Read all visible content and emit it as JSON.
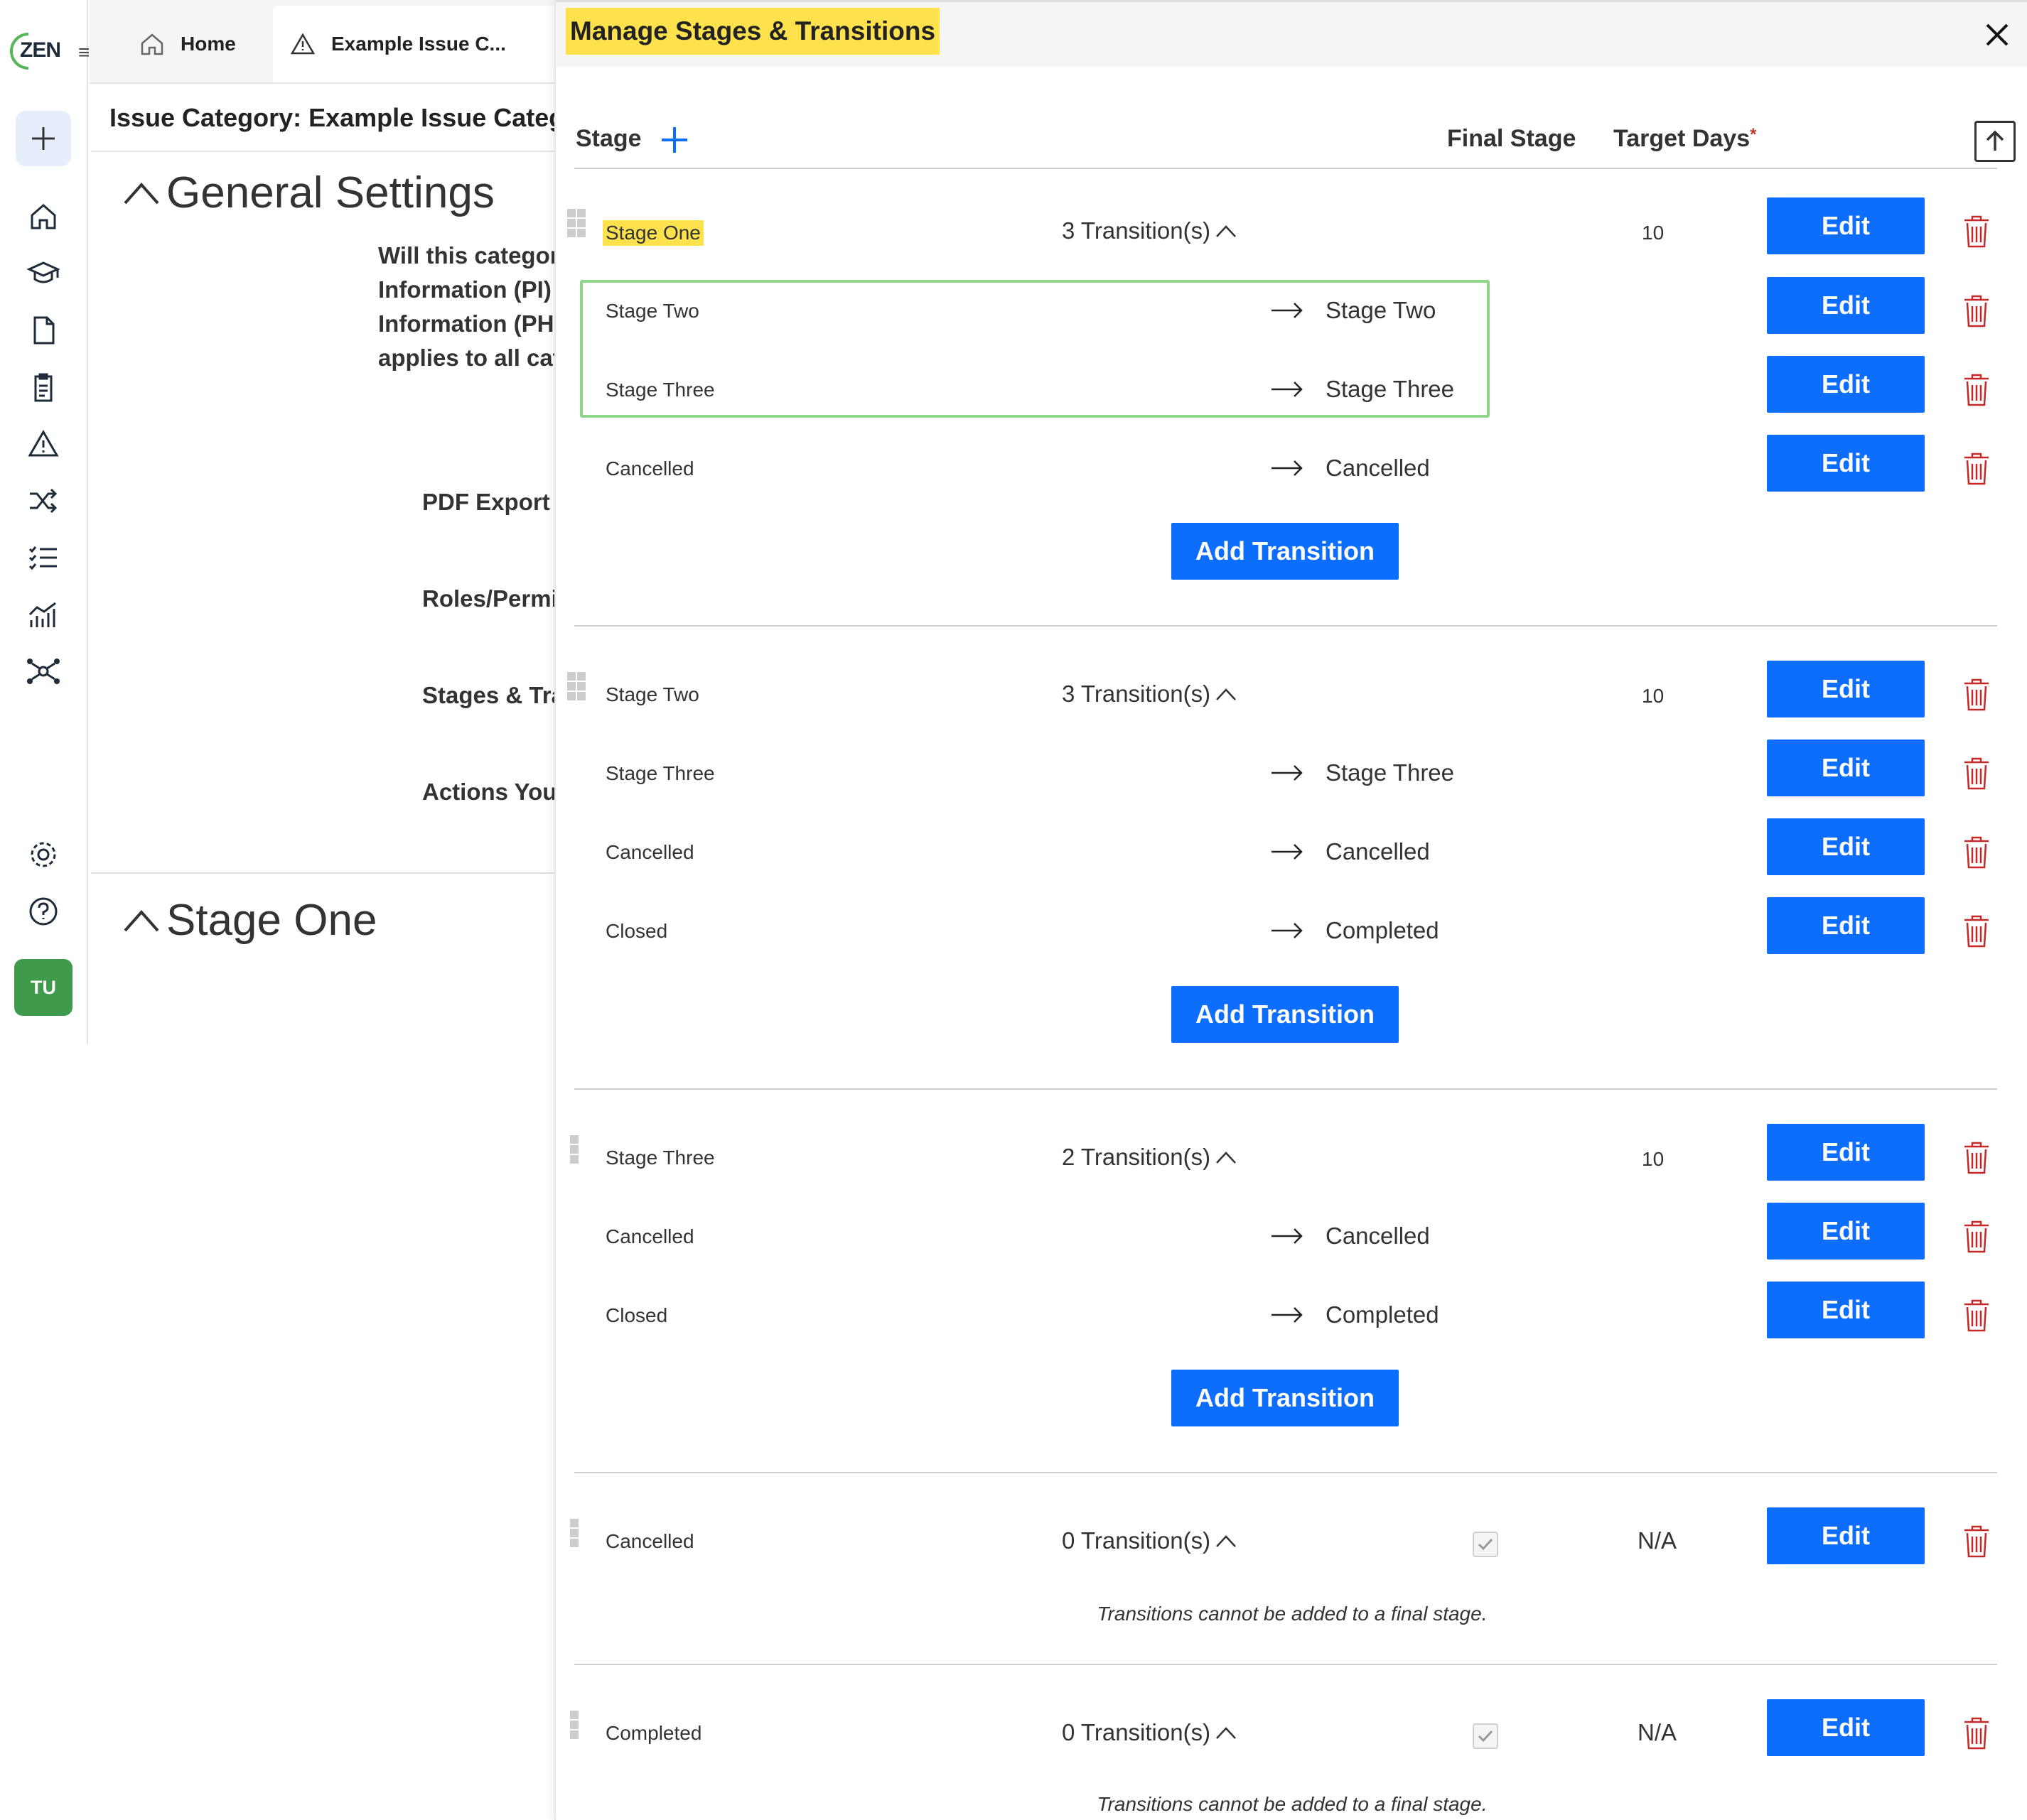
{
  "app": {
    "logo_text": "ZEN",
    "user_initials": "TU"
  },
  "tabs": [
    {
      "label": "Home"
    },
    {
      "label": "Example Issue C...",
      "close": "×"
    }
  ],
  "page": {
    "header": "Issue Category: Example Issue Category",
    "general_settings_title": "General Settings",
    "general_paragraph": [
      "Will this category",
      "Information (PI)",
      "Information (PH",
      "applies to all cate"
    ],
    "labels": [
      "PDF Export",
      "Roles/Permi",
      "Stages & Tra",
      "Actions You"
    ],
    "stage_one_title": "Stage One"
  },
  "modal": {
    "title": "Manage Stages & Transitions",
    "columns": {
      "stage": "Stage",
      "final_stage": "Final Stage",
      "target_days": "Target Days",
      "required_mark": "*"
    },
    "edit_label": "Edit",
    "add_transition_label": "Add Transition",
    "final_note": "Transitions cannot be added to a final stage.",
    "stages": [
      {
        "name": "Stage One",
        "transitions_count": "3 Transition(s)",
        "target_days": "10",
        "transitions": [
          {
            "name": "Stage Two",
            "target": "Stage Two"
          },
          {
            "name": "Stage Three",
            "target": "Stage Three"
          },
          {
            "name": "Cancelled",
            "target": "Cancelled"
          }
        ]
      },
      {
        "name": "Stage Two",
        "transitions_count": "3 Transition(s)",
        "target_days": "10",
        "transitions": [
          {
            "name": "Stage Three",
            "target": "Stage Three"
          },
          {
            "name": "Cancelled",
            "target": "Cancelled"
          },
          {
            "name": "Closed",
            "target": "Completed"
          }
        ]
      },
      {
        "name": "Stage Three",
        "transitions_count": "2 Transition(s)",
        "target_days": "10",
        "transitions": [
          {
            "name": "Cancelled",
            "target": "Cancelled"
          },
          {
            "name": "Closed",
            "target": "Completed"
          }
        ]
      },
      {
        "name": "Cancelled",
        "transitions_count": "0 Transition(s)",
        "target_days": "N/A",
        "final_stage": true
      },
      {
        "name": "Completed",
        "transitions_count": "0 Transition(s)",
        "target_days": "N/A",
        "final_stage": true
      }
    ]
  },
  "colors": {
    "primary": "#0d6efd",
    "highlight": "#fde24e",
    "delete": "#c62828",
    "focus_border": "#8fd68a",
    "avatar": "#3f9a4b"
  },
  "icons": [
    "home-icon",
    "graduation-cap-icon",
    "document-icon",
    "clipboard-icon",
    "warning-icon",
    "shuffle-icon",
    "checklist-icon",
    "chart-icon",
    "network-icon",
    "gear-icon",
    "help-icon",
    "plus-icon",
    "close-icon",
    "upload-icon",
    "arrow-right-icon",
    "trash-icon",
    "drag-handle-icon",
    "chevron-up-icon"
  ]
}
